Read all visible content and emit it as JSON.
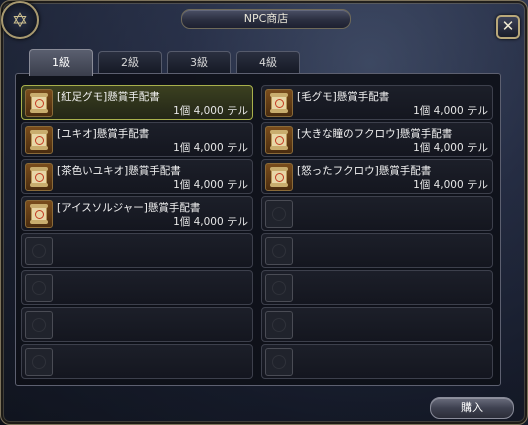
{
  "window": {
    "title": "NPC商店",
    "close_symbol": "✕",
    "emblem_symbol": "✡"
  },
  "tabs": [
    {
      "label": "1級",
      "active": true
    },
    {
      "label": "2級",
      "active": false
    },
    {
      "label": "3級",
      "active": false
    },
    {
      "label": "4級",
      "active": false
    }
  ],
  "items": [
    {
      "name": "[紅足グモ]懸賞手配書",
      "price": "1個 4,000 テル",
      "selected": true
    },
    {
      "name": "[毛グモ]懸賞手配書",
      "price": "1個 4,000 テル",
      "selected": false
    },
    {
      "name": "[ユキオ]懸賞手配書",
      "price": "1個 4,000 テル",
      "selected": false
    },
    {
      "name": "[大きな瞳のフクロウ]懸賞手配書",
      "price": "1個 4,000 テル",
      "selected": false
    },
    {
      "name": "[茶色いユキオ]懸賞手配書",
      "price": "1個 4,000 テル",
      "selected": false
    },
    {
      "name": "[怒ったフクロウ]懸賞手配書",
      "price": "1個 4,000 テル",
      "selected": false
    },
    {
      "name": "[アイスソルジャー]懸賞手配書",
      "price": "1個 4,000 テル",
      "selected": false
    }
  ],
  "empty_slot_count": 9,
  "buy_button": {
    "label": "購入"
  }
}
